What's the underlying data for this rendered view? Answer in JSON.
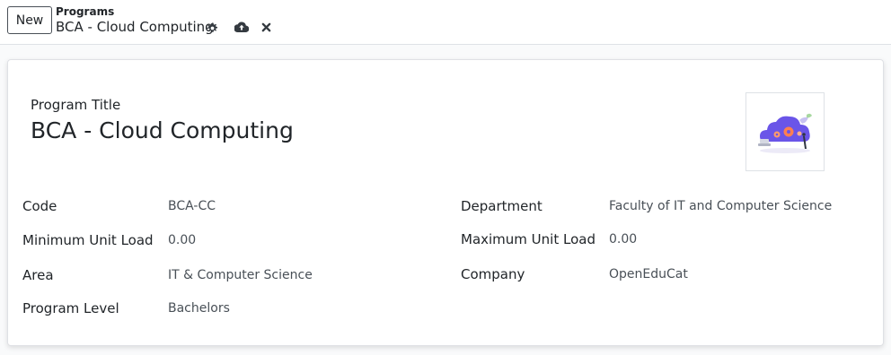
{
  "control_panel": {
    "new_label": "New",
    "breadcrumb_parent": "Programs",
    "breadcrumb_current": "BCA - Cloud Computing"
  },
  "icons": {
    "settings": "gear-icon",
    "save": "cloud-upload-icon",
    "discard": "close-icon"
  },
  "form": {
    "title_label": "Program Title",
    "title_value": "BCA - Cloud Computing",
    "left_fields": [
      {
        "label": "Code",
        "value": "BCA-CC"
      },
      {
        "label": "Minimum Unit Load",
        "value": "0.00"
      },
      {
        "label": "Area",
        "value": "IT & Computer Science"
      },
      {
        "label": "Program Level",
        "value": "Bachelors"
      }
    ],
    "right_fields": [
      {
        "label": "Department",
        "value": "Faculty of IT and Computer Science"
      },
      {
        "label": "Maximum Unit Load",
        "value": "0.00"
      },
      {
        "label": "Company",
        "value": "OpenEduCat"
      }
    ]
  },
  "colors": {
    "accent": "#6a55e8",
    "text": "#212529",
    "muted_value": "#495057"
  }
}
